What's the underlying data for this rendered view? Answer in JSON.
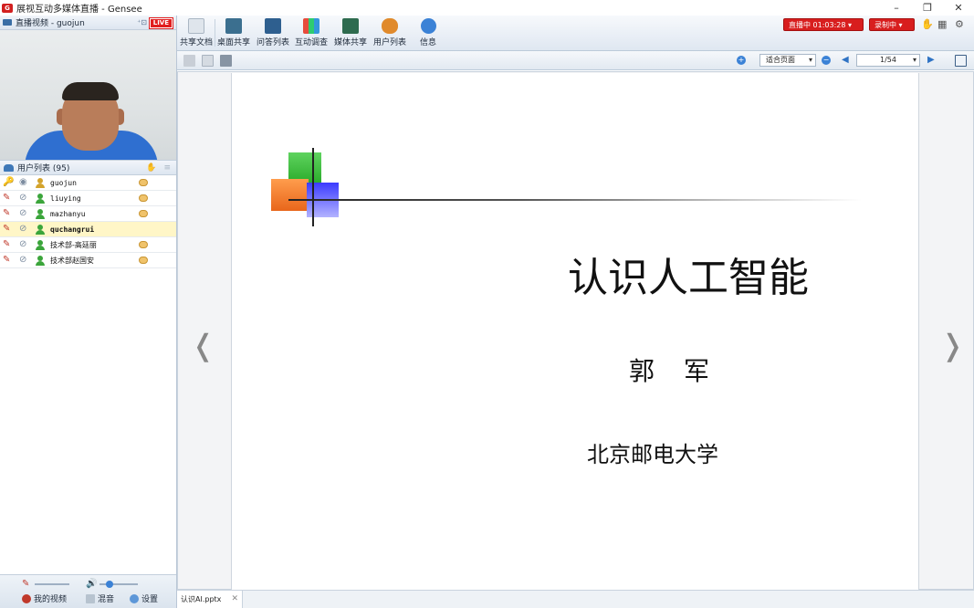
{
  "window": {
    "title": "展视互动多媒体直播 - Gensee",
    "icon_text": "G"
  },
  "video_panel": {
    "title": "直播视频 - guojun",
    "extra": "⁺⊡",
    "live": "LIVE"
  },
  "users_panel": {
    "title": "用户列表 (95)",
    "users": [
      {
        "name": "guojun",
        "role": "host"
      },
      {
        "name": "liuying",
        "role": "attendee"
      },
      {
        "name": "mazhanyu",
        "role": "attendee"
      },
      {
        "name": "quchangrui",
        "role": "attendee",
        "selected": true
      },
      {
        "name": "技术部-高廷丽",
        "role": "attendee"
      },
      {
        "name": "技术部赵国安",
        "role": "attendee"
      }
    ]
  },
  "left_footer": {
    "my_video": "我的视频",
    "mix": "混音",
    "settings": "设置"
  },
  "toolbar": {
    "items": [
      {
        "label": "共享文档",
        "icon": "share-doc-icon"
      },
      {
        "label": "桌面共享",
        "icon": "desktop-share-icon"
      },
      {
        "label": "问答列表",
        "icon": "qa-list-icon"
      },
      {
        "label": "互动调查",
        "icon": "survey-icon"
      },
      {
        "label": "媒体共享",
        "icon": "media-share-icon"
      },
      {
        "label": "用户列表",
        "icon": "user-list-icon"
      },
      {
        "label": "信息",
        "icon": "info-icon"
      }
    ],
    "live_status": "直播中 01:03:28 ▾",
    "record_status": "录制中 ▾"
  },
  "doc_toolbar": {
    "zoom": "适合页面",
    "page": "1/54"
  },
  "slide": {
    "title": "认识人工智能",
    "author": "郭　军",
    "institution": "北京邮电大学"
  },
  "doc_tabs": {
    "active": "认识AI.pptx"
  },
  "colors": {
    "accent": "#d81e1e",
    "primary": "#3b82d6"
  }
}
